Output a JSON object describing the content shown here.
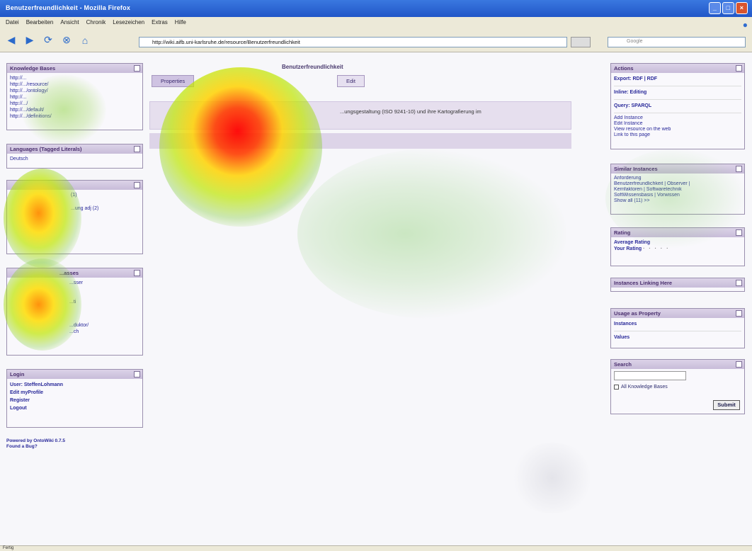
{
  "window": {
    "title": "Benutzerfreundlichkeit - Mozilla Firefox",
    "buttons": [
      "_",
      "□",
      "×"
    ]
  },
  "menu": [
    "Datei",
    "Bearbeiten",
    "Ansicht",
    "Chronik",
    "Lesezeichen",
    "Extras",
    "Hilfe"
  ],
  "nav": {
    "url": "http://wiki.aifb.uni-karlsruhe.de/resource/Benutzerfreundlichkeit",
    "search_placeholder": "Google"
  },
  "knowledge_bases": {
    "title": "Knowledge Bases",
    "items": [
      "http://...",
      "http://.../resource/",
      "http://.../ontology/",
      "http://...",
      "http://.../",
      "http://.../default/",
      "http://.../definitions/"
    ]
  },
  "languages": {
    "title": "Languages (Tagged Literals)",
    "item": "Deutsch"
  },
  "box3": {
    "title": "",
    "items": [
      "(1)",
      "(2)",
      "...ung adj (2)",
      "..."
    ]
  },
  "box4": {
    "title": "...asses",
    "items": [
      "...sser",
      "...",
      "...ti",
      "...",
      "...duktor/",
      "...ch"
    ]
  },
  "login": {
    "title": "Login",
    "items": [
      "User: SteffenLohmann",
      "Edit myProfile",
      "Register",
      "Logout"
    ]
  },
  "footer": {
    "powered": "Powered by OntoWiki 0.7.5",
    "bug": "Found a Bug?"
  },
  "page": {
    "title": "Benutzerfreundlichkeit",
    "tabs": [
      "Properties",
      "Edit"
    ],
    "description": "...ungsgestaltung (ISO 9241-10) und ihre Kartografierung im"
  },
  "actions": {
    "title": "Actions",
    "items": [
      "Export: RDF | RDF",
      "Inline: Editing",
      "Query: SPARQL"
    ],
    "sub_items": [
      "Add Instance",
      "Edit Instance",
      "View resource on the web",
      "Link to this page"
    ]
  },
  "similar": {
    "title": "Similar Instances",
    "items": [
      "Anforderung",
      "Benutzerfreundlichkeit | Observer |",
      "Kernfaktoren | Softwaretechnik",
      "SoftWissensbasis | Vorwissen",
      "Show all (11) >>"
    ]
  },
  "rating": {
    "title": "Rating",
    "average": "Average Rating",
    "your": "Your Rating",
    "stars": "· · · · ·"
  },
  "instances_linking": {
    "title": "Instances Linking Here"
  },
  "usage": {
    "title": "Usage as Property",
    "items": [
      "Instances",
      "Values"
    ]
  },
  "search": {
    "title": "Search",
    "checkbox_label": "All Knowledge Bases",
    "submit": "Submit"
  },
  "status": {
    "text": "Fertig"
  },
  "colors": {
    "accent": "#4a2f6e",
    "box_header": "#cfc3e2",
    "link": "#2a2a9a"
  },
  "heatmap_overlay": {
    "hotspots": 5
  }
}
